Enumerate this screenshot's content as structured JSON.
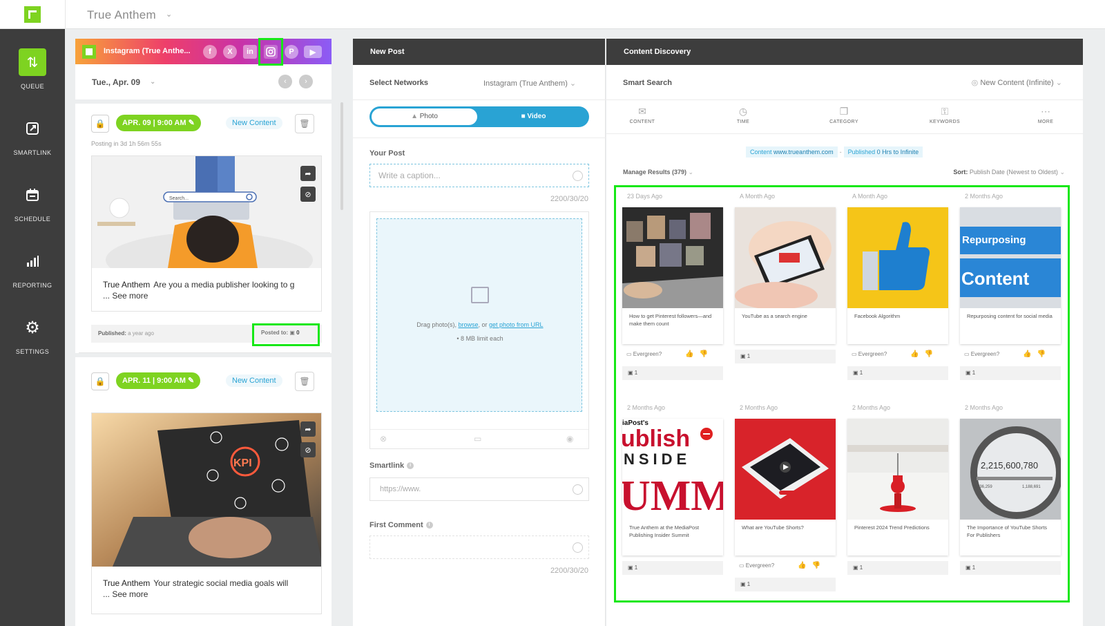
{
  "header": {
    "org_name": "True Anthem"
  },
  "nav": [
    {
      "label": "QUEUE",
      "icon": "queue-icon"
    },
    {
      "label": "SMARTLINK",
      "icon": "smartlink-icon"
    },
    {
      "label": "SCHEDULE",
      "icon": "schedule-icon"
    },
    {
      "label": "REPORTING",
      "icon": "reporting-icon"
    },
    {
      "label": "SETTINGS",
      "icon": "settings-icon"
    }
  ],
  "queue": {
    "account_title": "Instagram (True Anthe...",
    "date": "Tue., Apr. 09",
    "posts": [
      {
        "date_pill": "APR. 09 | 9:00 AM",
        "badge": "New Content",
        "posting_in": "Posting in 3d 1h 56m 55s",
        "author": "True Anthem",
        "caption": "Are you a media publisher looking to g",
        "see_more": "... See more",
        "published_label": "Published:",
        "published_value": "a year ago",
        "posted_label": "Posted to:",
        "posted_count": "0",
        "search_text": "Search..."
      },
      {
        "date_pill": "APR. 11 | 9:00 AM",
        "badge": "New Content",
        "author": "True Anthem",
        "caption": "Your strategic social media goals will",
        "see_more": "... See more",
        "kpi_text": "KPI"
      }
    ]
  },
  "new_post": {
    "title": "New Post",
    "select_networks_label": "Select Networks",
    "select_networks_value": "Instagram (True Anthem)",
    "photo_label": "Photo",
    "video_label": "Video",
    "your_post_label": "Your Post",
    "caption_placeholder": "Write a caption...",
    "caption_counter": "2200/30/20",
    "drop_text_1": "Drag photo(s),",
    "drop_browse": "browse",
    "drop_text_2": ", or",
    "drop_url": "get photo from URL",
    "drop_limit": "• 8 MB limit each",
    "smartlink_label": "Smartlink",
    "smartlink_placeholder": "https://www.",
    "first_comment_label": "First Comment",
    "comment_counter": "2200/30/20"
  },
  "discovery": {
    "title": "Content Discovery",
    "smart_search_label": "Smart Search",
    "new_content_select": "New Content (Infinite)",
    "filters": [
      {
        "label": "CONTENT",
        "icon": "content-icon"
      },
      {
        "label": "TIME",
        "icon": "clock-icon"
      },
      {
        "label": "CATEGORY",
        "icon": "category-icon"
      },
      {
        "label": "KEYWORDS",
        "icon": "key-icon"
      },
      {
        "label": "MORE",
        "icon": "more-icon"
      }
    ],
    "chip_content_label": "Content",
    "chip_content_value": "www.trueanthem.com",
    "chip_published_label": "Published",
    "chip_published_value": "0 Hrs to Infinite",
    "manage_results": "Manage Results (379)",
    "sort_label": "Sort:",
    "sort_value": "Publish Date (Newest to Oldest)",
    "evergreen_label": "Evergreen?",
    "tiles": [
      {
        "age": "23 Days Ago",
        "title": "How to get Pinterest followers—and make them count",
        "ig_count": "1",
        "evergreen": true,
        "theme": "pinterest"
      },
      {
        "age": "A Month Ago",
        "title": "YouTube as a search engine",
        "ig_count": "1",
        "evergreen": false,
        "theme": "tablet"
      },
      {
        "age": "A Month Ago",
        "title": "Facebook Algorithm",
        "ig_count": "1",
        "evergreen": true,
        "theme": "thumb"
      },
      {
        "age": "2 Months Ago",
        "title": "Repurposing content for social media",
        "ig_count": "1",
        "evergreen": true,
        "theme": "keyboard",
        "img_text_1": "Repurposing",
        "img_text_2": "Content"
      },
      {
        "age": "2 Months Ago",
        "title": "True Anthem at the MediaPost Publishing Insider Summit",
        "ig_count": "1",
        "evergreen": false,
        "theme": "mediapost",
        "img_text_1": "iaPost's",
        "img_text_2": "ublish",
        "img_text_3": "NSIDE",
        "img_text_4": "UMMI"
      },
      {
        "age": "2 Months Ago",
        "title": "What are YouTube Shorts?",
        "ig_count": "1",
        "evergreen": true,
        "theme": "shorts"
      },
      {
        "age": "2 Months Ago",
        "title": "Pinterest 2024 Trend Predictions",
        "ig_count": "1",
        "evergreen": false,
        "theme": "pin"
      },
      {
        "age": "2 Months Ago",
        "title": "The Importance of YouTube Shorts For Publishers",
        "ig_count": "1",
        "evergreen": false,
        "theme": "magnifier",
        "img_text_1": "2,215,600,780",
        "img_text_2": "9,036,259",
        "img_text_3": "1,188,691"
      }
    ]
  },
  "colors": {
    "brand_green": "#7ed321",
    "accent_blue": "#29a3d4",
    "highlight": "#16e816",
    "nav_dark": "#3d3d3d"
  }
}
